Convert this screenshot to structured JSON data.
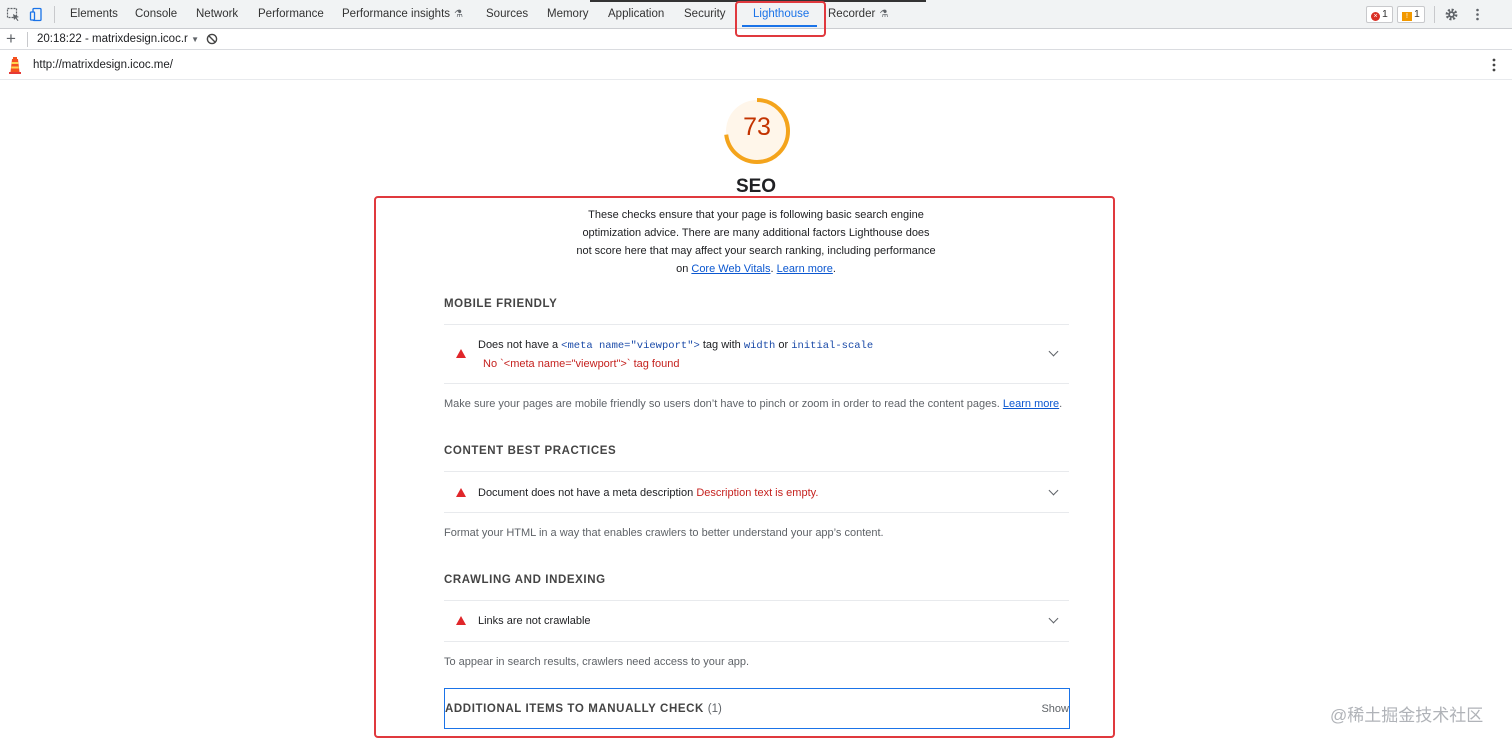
{
  "tabs": [
    {
      "label": "Elements"
    },
    {
      "label": "Console"
    },
    {
      "label": "Network"
    },
    {
      "label": "Performance"
    },
    {
      "label": "Performance insights"
    },
    {
      "label": "Sources"
    },
    {
      "label": "Memory"
    },
    {
      "label": "Application"
    },
    {
      "label": "Security"
    },
    {
      "label": "Lighthouse"
    },
    {
      "label": "Recorder"
    }
  ],
  "active_tab": "Lighthouse",
  "badges": {
    "errors": "1",
    "warnings": "1"
  },
  "report_selector": {
    "value": "20:18:22 - matrixdesign.icoc.r"
  },
  "url": "http://matrixdesign.icoc.me/",
  "score": {
    "value": "73",
    "fraction": 0.73,
    "color": "#f4a41c"
  },
  "category_title": "SEO",
  "description": {
    "line1": "These checks ensure that your page is following basic search engine",
    "line2": "optimization advice. There are many additional factors Lighthouse does",
    "line3": "not score here that may affect your search ranking, including performance",
    "line4_prefix": "on ",
    "link1": "Core Web Vitals",
    "sep": ". ",
    "link2": "Learn more",
    "end": "."
  },
  "groups": {
    "mobile": {
      "title": "MOBILE FRIENDLY",
      "audit": {
        "t1": "Does not have a ",
        "code1": "<meta name=\"viewport\">",
        "t2": " tag with ",
        "code2": "width",
        "t3": " or ",
        "code3": "initial-scale",
        "fail": "No `<meta name=\"viewport\">` tag found"
      },
      "desc": "Make sure your pages are mobile friendly so users don’t have to pinch or zoom in order to read the content pages. ",
      "desc_link": "Learn more",
      "desc_end": "."
    },
    "content": {
      "title": "CONTENT BEST PRACTICES",
      "audit": {
        "title": "Document does not have a meta description",
        "fail": "Description text is empty."
      },
      "desc": "Format your HTML in a way that enables crawlers to better understand your app’s content."
    },
    "crawling": {
      "title": "CRAWLING AND INDEXING",
      "audit": {
        "title": "Links are not crawlable"
      },
      "desc": "To appear in search results, crawlers need access to your app."
    }
  },
  "manual": {
    "title": "ADDITIONAL ITEMS TO MANUALLY CHECK",
    "count": "(1)",
    "show": "Show"
  },
  "watermark": "@稀土掘金技术社区"
}
